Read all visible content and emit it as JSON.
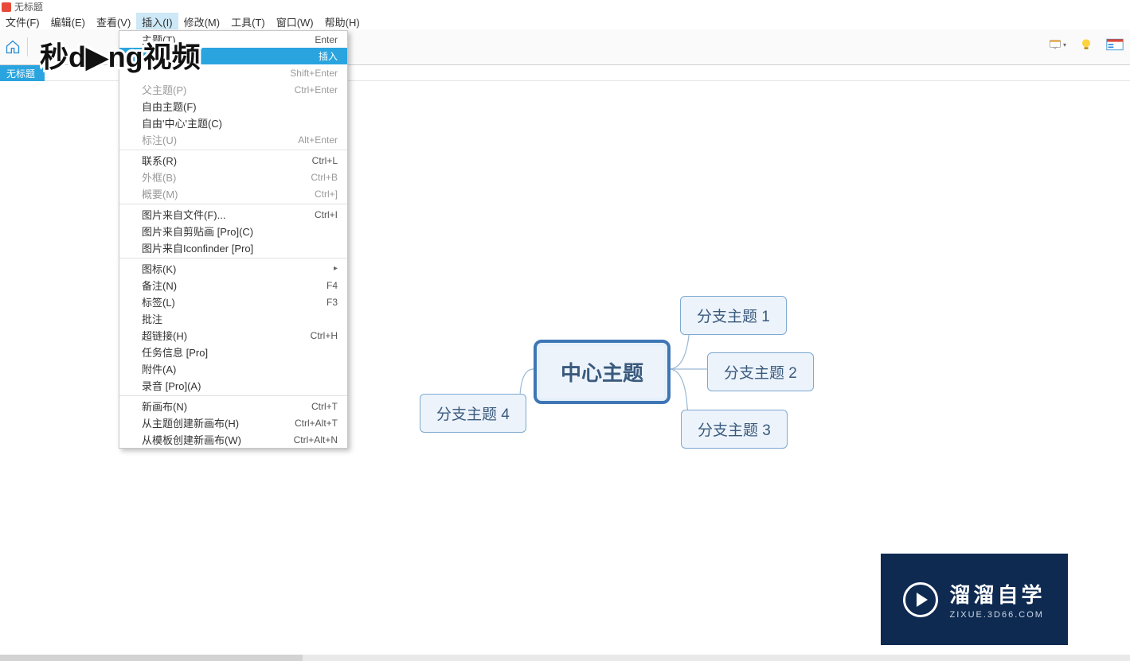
{
  "window": {
    "title": "无标题"
  },
  "menubar": [
    {
      "label": "文件(F)"
    },
    {
      "label": "编辑(E)"
    },
    {
      "label": "查看(V)"
    },
    {
      "label": "插入(I)",
      "active": true
    },
    {
      "label": "修改(M)"
    },
    {
      "label": "工具(T)"
    },
    {
      "label": "窗口(W)"
    },
    {
      "label": "帮助(H)"
    }
  ],
  "tab": {
    "label": "无标题"
  },
  "menu": {
    "groups": [
      [
        {
          "label": "主题(T)",
          "shortcut": "Enter",
          "disabled": false
        },
        {
          "label": "",
          "shortcut": "插入",
          "highlight": true,
          "shortcutOnly": true
        },
        {
          "label": "",
          "shortcut": "Shift+Enter",
          "disabled": true,
          "shortcutOnly": true
        },
        {
          "label": "父主题(P)",
          "shortcut": "Ctrl+Enter",
          "disabled": true
        },
        {
          "label": "自由主题(F)",
          "shortcut": ""
        },
        {
          "label": "自由'中心'主题(C)",
          "shortcut": ""
        },
        {
          "label": "标注(U)",
          "shortcut": "Alt+Enter",
          "disabled": true
        }
      ],
      [
        {
          "label": "联系(R)",
          "shortcut": "Ctrl+L"
        },
        {
          "label": "外框(B)",
          "shortcut": "Ctrl+B",
          "disabled": true
        },
        {
          "label": "概要(M)",
          "shortcut": "Ctrl+]",
          "disabled": true
        }
      ],
      [
        {
          "label": "图片来自文件(F)...",
          "shortcut": "Ctrl+I"
        },
        {
          "label": "图片来自剪贴画 [Pro](C)",
          "shortcut": ""
        },
        {
          "label": "图片来自Iconfinder [Pro]",
          "shortcut": ""
        }
      ],
      [
        {
          "label": "图标(K)",
          "shortcut": "",
          "submenu": true
        },
        {
          "label": "备注(N)",
          "shortcut": "F4"
        },
        {
          "label": "标签(L)",
          "shortcut": "F3"
        },
        {
          "label": "批注",
          "shortcut": ""
        },
        {
          "label": "超链接(H)",
          "shortcut": "Ctrl+H"
        },
        {
          "label": "任务信息 [Pro]",
          "shortcut": ""
        },
        {
          "label": "附件(A)",
          "shortcut": ""
        },
        {
          "label": "录音 [Pro](A)",
          "shortcut": ""
        }
      ],
      [
        {
          "label": "新画布(N)",
          "shortcut": "Ctrl+T"
        },
        {
          "label": "从主题创建新画布(H)",
          "shortcut": "Ctrl+Alt+T"
        },
        {
          "label": "从模板创建新画布(W)",
          "shortcut": "Ctrl+Alt+N"
        }
      ]
    ]
  },
  "mindmap": {
    "center": "中心主题",
    "branches": [
      "分支主题 1",
      "分支主题 2",
      "分支主题 3",
      "分支主题 4"
    ]
  },
  "brand": {
    "line1": "溜溜自学",
    "line2": "ZIXUE.3D66.COM"
  },
  "watermark": {
    "text": "秒dong视频"
  }
}
